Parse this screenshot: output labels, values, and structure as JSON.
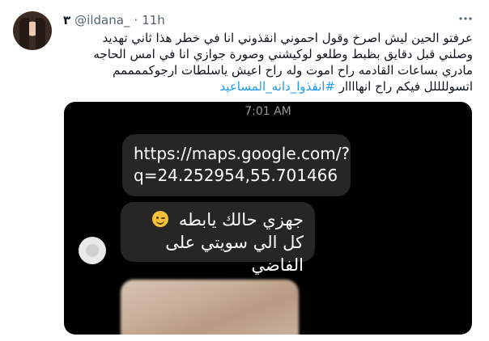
{
  "tweet": {
    "display_name": "٣",
    "handle": "@ildana_",
    "separator": "·",
    "time": "11h",
    "text": "عرفتو الحين ليش اصرخ وقول احموني انقذوني انا في خطر هذا ثاني تهديد وصلني قبل دقايق بظبط وطلعو لوكيشني وصورة جوازي انا في امس الحاجه مادري بساعات القادمه راح اموت وله راح اعيش ياسلطات ارجوكممممم اتسوللللل فيكم راح انهاااار ",
    "hashtag": "#انقذوا_دانه_المساعيد"
  },
  "media": {
    "time": "7:01 AM",
    "link_message": "https://maps.google.com/?q=24.252954,55.701466",
    "message_line1": "جهزي حالك يابطه",
    "message_line2": "كل الي سويتي على الفاضي",
    "emoji": "winking-face"
  },
  "colors": {
    "hashtag": "#1d9bf0",
    "media_background": "#000000",
    "bubble": "#262626"
  }
}
